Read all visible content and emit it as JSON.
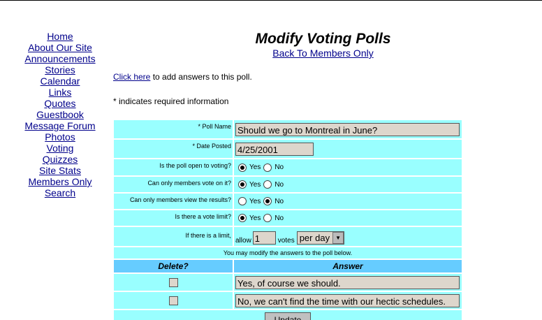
{
  "nav": [
    "Home",
    "About Our Site",
    "Announcements",
    "Stories",
    "Calendar",
    "Links",
    "Quotes",
    "Guestbook",
    "Message Forum",
    "Photos",
    "Voting",
    "Quizzes",
    "Site Stats",
    "Members Only",
    "Search"
  ],
  "page_title": "Modify Voting Polls",
  "back_link": "Back To Members Only",
  "add_link": "Click here",
  "add_text": " to add answers to this poll.",
  "required_note": "* indicates required information",
  "form": {
    "poll_name_label": "* Poll Name",
    "poll_name_value": "Should we go to Montreal in June?",
    "date_label": "* Date Posted",
    "date_value": "4/25/2001",
    "open_label": "Is the poll open to voting?",
    "members_vote_label": "Can only members vote on it?",
    "members_view_label": "Can only members view the results?",
    "limit_label": "Is there a vote limit?",
    "limit_amount_label": "If there is a limit,",
    "allow_text": "allow",
    "allow_value": "1",
    "votes_text": "votes",
    "period_value": "per day",
    "yes": "Yes",
    "no": "No",
    "modify_note": "You may modify the answers to the poll below.",
    "delete_header": "Delete?",
    "answer_header": "Answer",
    "answers": [
      "Yes, of course we should.",
      "No, we can't find the time with our hectic schedules."
    ],
    "update_label": "Update"
  }
}
